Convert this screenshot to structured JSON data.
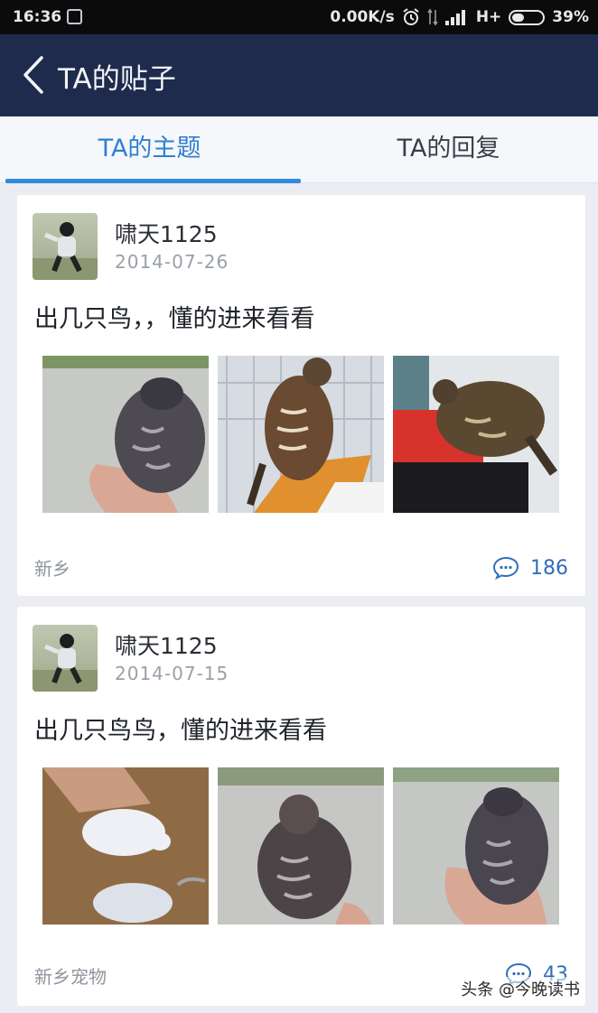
{
  "status_bar": {
    "time": "16:36",
    "network_speed": "0.00K/s",
    "network_type": "H+",
    "battery": "39%"
  },
  "nav": {
    "title": "TA的贴子"
  },
  "tabs": [
    {
      "label": "TA的主题",
      "active": true
    },
    {
      "label": "TA的回复",
      "active": false
    }
  ],
  "posts": [
    {
      "username": "啸天1125",
      "date": "2014-07-26",
      "title": "出几只鸟，，懂的进来看看",
      "location": "新乡",
      "comment_count": "186"
    },
    {
      "username": "啸天1125",
      "date": "2014-07-15",
      "title": "出几只鸟鸟，懂的进来看看",
      "location": "新乡宠物",
      "comment_count": "43"
    }
  ],
  "watermark": "头条 @今晚读书",
  "colors": {
    "nav_bg": "#1f2b4c",
    "accent": "#2f7fd3",
    "comment_text": "#2f6fb8",
    "page_bg": "#ebedf2"
  }
}
